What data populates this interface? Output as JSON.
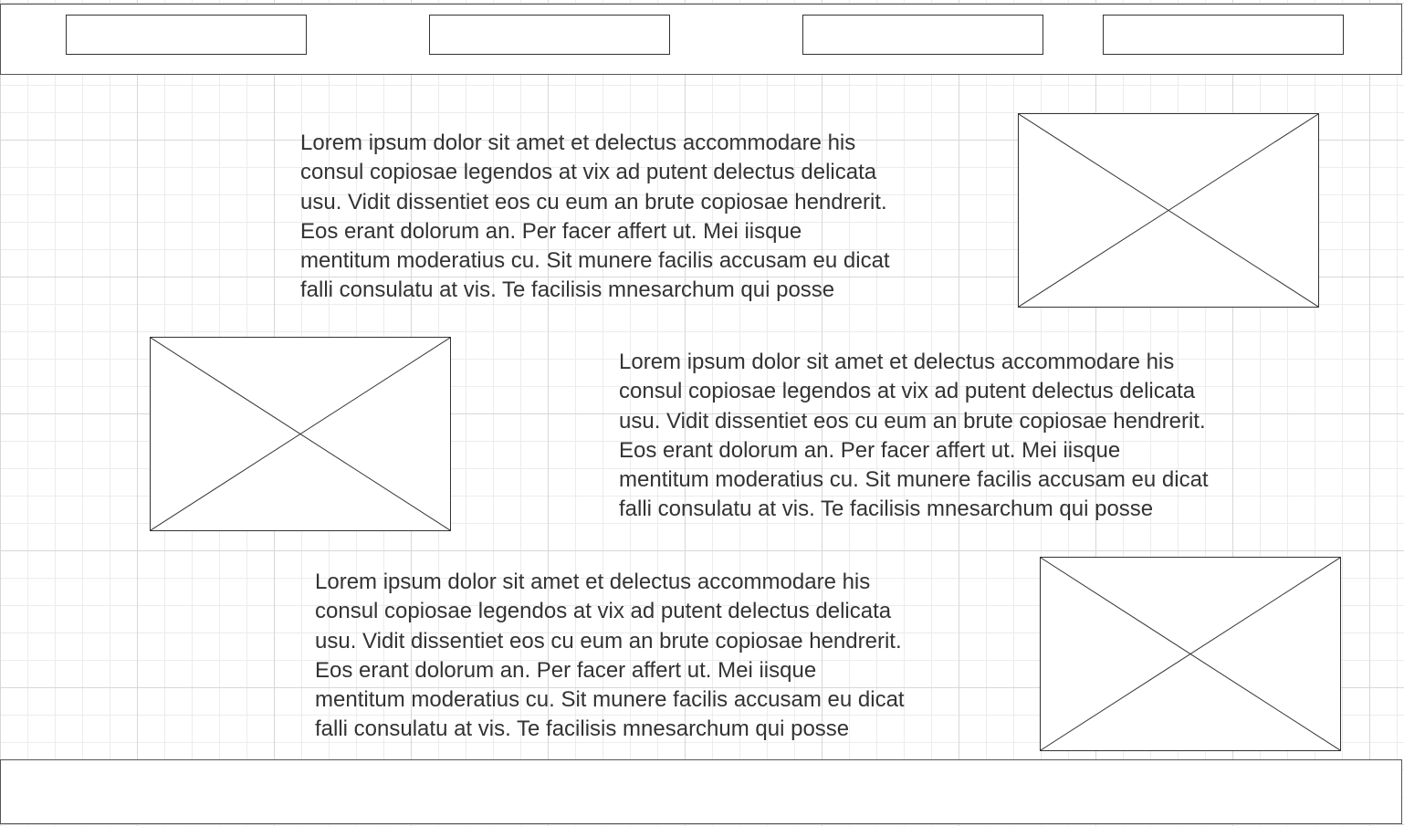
{
  "header": {
    "nav_boxes": [
      "",
      "",
      "",
      ""
    ]
  },
  "sections": [
    {
      "text": "Lorem ipsum dolor sit amet et delectus accommodare his\nconsul copiosae legendos at vix ad putent delectus delicata\nusu. Vidit dissentiet eos cu eum an brute copiosae hendrerit.\nEos erant dolorum an. Per facer affert ut. Mei iisque\nmentitum moderatius cu. Sit munere facilis accusam eu dicat\nfalli consulatu at vis. Te facilisis mnesarchum qui posse",
      "image": "image-placeholder"
    },
    {
      "text": "Lorem ipsum dolor sit amet et delectus accommodare his\nconsul copiosae legendos at vix ad putent delectus delicata\nusu. Vidit dissentiet eos cu eum an brute copiosae hendrerit.\nEos erant dolorum an. Per facer affert ut. Mei iisque\nmentitum moderatius cu. Sit munere facilis accusam eu dicat\nfalli consulatu at vis. Te facilisis mnesarchum qui posse",
      "image": "image-placeholder"
    },
    {
      "text": "Lorem ipsum dolor sit amet et delectus accommodare his\nconsul copiosae legendos at vix ad putent delectus delicata\nusu. Vidit dissentiet eos cu eum an brute copiosae hendrerit.\nEos erant dolorum an. Per facer affert ut. Mei iisque\nmentitum moderatius cu. Sit munere facilis accusam eu dicat\nfalli consulatu at vis. Te facilisis mnesarchum qui posse",
      "image": "image-placeholder"
    }
  ],
  "footer": {
    "text": ""
  },
  "colors": {
    "stroke": "#333333",
    "text": "#333333",
    "grid_major": "#d7d7d7",
    "grid_minor": "#ececec",
    "background": "#ffffff"
  }
}
